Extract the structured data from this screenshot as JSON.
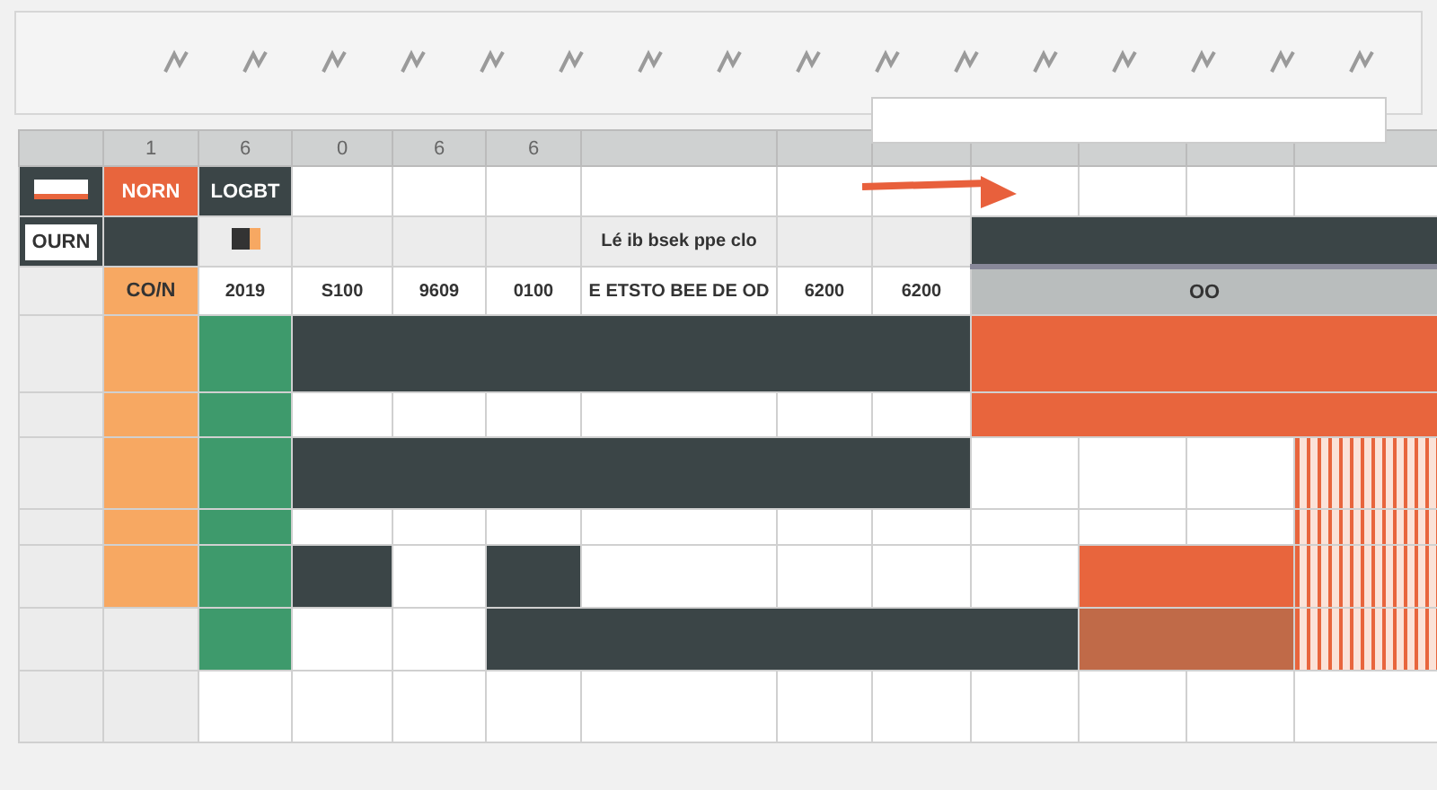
{
  "column_headers": [
    "1",
    "6",
    "0",
    "6",
    "6"
  ],
  "rows": [
    {
      "cells": [
        {
          "kind": "flag"
        },
        {
          "kind": "orange",
          "text": "NORN"
        },
        {
          "kind": "dark",
          "text": "LOGBT"
        },
        {
          "kind": "white"
        },
        {
          "kind": "white"
        },
        {
          "kind": "white"
        },
        {
          "kind": "white"
        },
        {
          "kind": "white"
        },
        {
          "kind": "white"
        },
        {
          "kind": "white"
        },
        {
          "kind": "white"
        },
        {
          "kind": "white"
        },
        {
          "kind": "white"
        }
      ]
    },
    {
      "cells": [
        {
          "kind": "box",
          "text": "OURN"
        },
        {
          "kind": "dark"
        },
        {
          "kind": "chip"
        },
        {
          "kind": "light"
        },
        {
          "kind": "light"
        },
        {
          "kind": "light"
        },
        {
          "kind": "light",
          "text": "Lé ib bsek ppe clo"
        },
        {
          "kind": "light"
        },
        {
          "kind": "light"
        },
        {
          "kind": "toolbar"
        },
        {
          "kind": "toolbar"
        },
        {
          "kind": "toolbar"
        },
        {
          "kind": "toolbar"
        }
      ]
    },
    {
      "cells": [
        {
          "kind": "light"
        },
        {
          "kind": "peach",
          "text": "CO/N"
        },
        {
          "kind": "white",
          "text": "2019"
        },
        {
          "kind": "white",
          "text": "S100"
        },
        {
          "kind": "white",
          "text": "9609"
        },
        {
          "kind": "white",
          "text": "0100"
        },
        {
          "kind": "white",
          "text": "E ETSTO BEE DE OD"
        },
        {
          "kind": "white",
          "text": "6200"
        },
        {
          "kind": "white",
          "text": "6200"
        },
        {
          "kind": "grey",
          "text": "OO"
        },
        {
          "kind": "grey"
        },
        {
          "kind": "grey"
        },
        {
          "kind": "grey"
        }
      ]
    },
    {
      "cells": [
        {
          "kind": "light"
        },
        {
          "kind": "peach"
        },
        {
          "kind": "green"
        },
        {
          "kind": "dark"
        },
        {
          "kind": "dark"
        },
        {
          "kind": "dark"
        },
        {
          "kind": "dark"
        },
        {
          "kind": "dark"
        },
        {
          "kind": "dark"
        },
        {
          "kind": "orange"
        },
        {
          "kind": "orange"
        },
        {
          "kind": "orange"
        },
        {
          "kind": "orange"
        }
      ]
    },
    {
      "cells": [
        {
          "kind": "light"
        },
        {
          "kind": "peach"
        },
        {
          "kind": "green"
        },
        {
          "kind": "white"
        },
        {
          "kind": "white"
        },
        {
          "kind": "white"
        },
        {
          "kind": "white"
        },
        {
          "kind": "white"
        },
        {
          "kind": "white"
        },
        {
          "kind": "orange"
        },
        {
          "kind": "orange"
        },
        {
          "kind": "orange"
        },
        {
          "kind": "orange"
        }
      ]
    },
    {
      "cells": [
        {
          "kind": "light"
        },
        {
          "kind": "peach"
        },
        {
          "kind": "green"
        },
        {
          "kind": "dark"
        },
        {
          "kind": "dark"
        },
        {
          "kind": "dark"
        },
        {
          "kind": "dark"
        },
        {
          "kind": "dark"
        },
        {
          "kind": "dark"
        },
        {
          "kind": "white"
        },
        {
          "kind": "white"
        },
        {
          "kind": "white"
        },
        {
          "kind": "stripes"
        }
      ]
    },
    {
      "cells": [
        {
          "kind": "light"
        },
        {
          "kind": "peach"
        },
        {
          "kind": "green"
        },
        {
          "kind": "white"
        },
        {
          "kind": "white"
        },
        {
          "kind": "white"
        },
        {
          "kind": "white"
        },
        {
          "kind": "white"
        },
        {
          "kind": "white"
        },
        {
          "kind": "white"
        },
        {
          "kind": "white"
        },
        {
          "kind": "white"
        },
        {
          "kind": "stripes"
        }
      ]
    },
    {
      "cells": [
        {
          "kind": "light"
        },
        {
          "kind": "peach"
        },
        {
          "kind": "green"
        },
        {
          "kind": "dark"
        },
        {
          "kind": "white"
        },
        {
          "kind": "dark"
        },
        {
          "kind": "white"
        },
        {
          "kind": "white"
        },
        {
          "kind": "white"
        },
        {
          "kind": "white"
        },
        {
          "kind": "orange"
        },
        {
          "kind": "orange"
        },
        {
          "kind": "stripes"
        }
      ]
    },
    {
      "cells": [
        {
          "kind": "light"
        },
        {
          "kind": "light"
        },
        {
          "kind": "green"
        },
        {
          "kind": "white"
        },
        {
          "kind": "white"
        },
        {
          "kind": "dark"
        },
        {
          "kind": "dark"
        },
        {
          "kind": "dark"
        },
        {
          "kind": "dark"
        },
        {
          "kind": "dark"
        },
        {
          "kind": "brown"
        },
        {
          "kind": "brown"
        },
        {
          "kind": "stripes"
        }
      ]
    },
    {
      "cells": [
        {
          "kind": "light"
        },
        {
          "kind": "light"
        },
        {
          "kind": "white"
        },
        {
          "kind": "white"
        },
        {
          "kind": "white"
        },
        {
          "kind": "white"
        },
        {
          "kind": "white"
        },
        {
          "kind": "white"
        },
        {
          "kind": "white"
        },
        {
          "kind": "white"
        },
        {
          "kind": "white"
        },
        {
          "kind": "white"
        },
        {
          "kind": "white"
        }
      ]
    }
  ]
}
